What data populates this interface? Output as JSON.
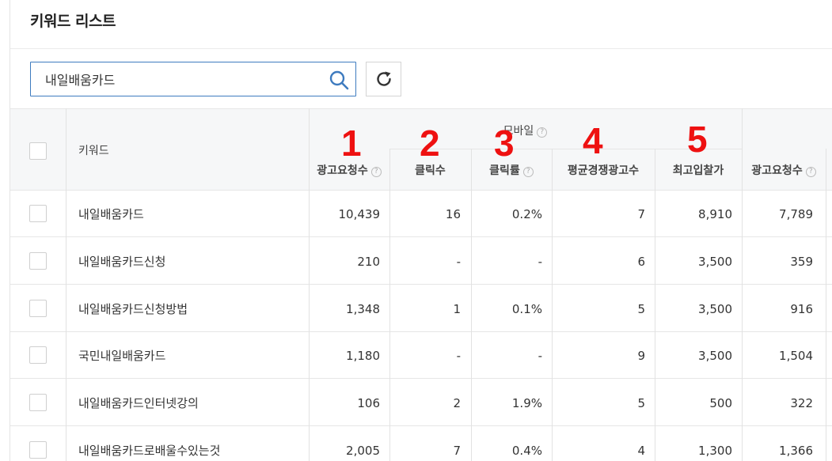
{
  "page": {
    "title": "키워드 리스트"
  },
  "search": {
    "value": "내일배움카드"
  },
  "table": {
    "col_keyword": "키워드",
    "group_mobile": "모바일",
    "columns": [
      "광고요청수",
      "클릭수",
      "클릭률",
      "평균경쟁광고수",
      "최고입찰가",
      "광고요청수"
    ],
    "rows": [
      {
        "keyword": "내일배움카드",
        "requests": "10,439",
        "clicks": "16",
        "ctr": "0.2%",
        "comp": "7",
        "bid": "8,910",
        "requests2": "7,789"
      },
      {
        "keyword": "내일배움카드신청",
        "requests": "210",
        "clicks": "-",
        "ctr": "-",
        "comp": "6",
        "bid": "3,500",
        "requests2": "359"
      },
      {
        "keyword": "내일배움카드신청방법",
        "requests": "1,348",
        "clicks": "1",
        "ctr": "0.1%",
        "comp": "5",
        "bid": "3,500",
        "requests2": "916"
      },
      {
        "keyword": "국민내일배움카드",
        "requests": "1,180",
        "clicks": "-",
        "ctr": "-",
        "comp": "9",
        "bid": "3,500",
        "requests2": "1,504"
      },
      {
        "keyword": "내일배움카드인터넷강의",
        "requests": "106",
        "clicks": "2",
        "ctr": "1.9%",
        "comp": "5",
        "bid": "500",
        "requests2": "322"
      },
      {
        "keyword": "내일배움카드로배울수있는것",
        "requests": "2,005",
        "clicks": "7",
        "ctr": "0.4%",
        "comp": "4",
        "bid": "1,300",
        "requests2": "1,366"
      }
    ]
  },
  "annotations": [
    "1",
    "2",
    "3",
    "4",
    "5"
  ],
  "colors": {
    "accent": "#3e7bbf",
    "annotation": "#ee1111",
    "header_bg": "#f6f7f8"
  },
  "icons": {
    "search": "search-icon",
    "refresh": "refresh-icon",
    "help": "help-icon"
  }
}
